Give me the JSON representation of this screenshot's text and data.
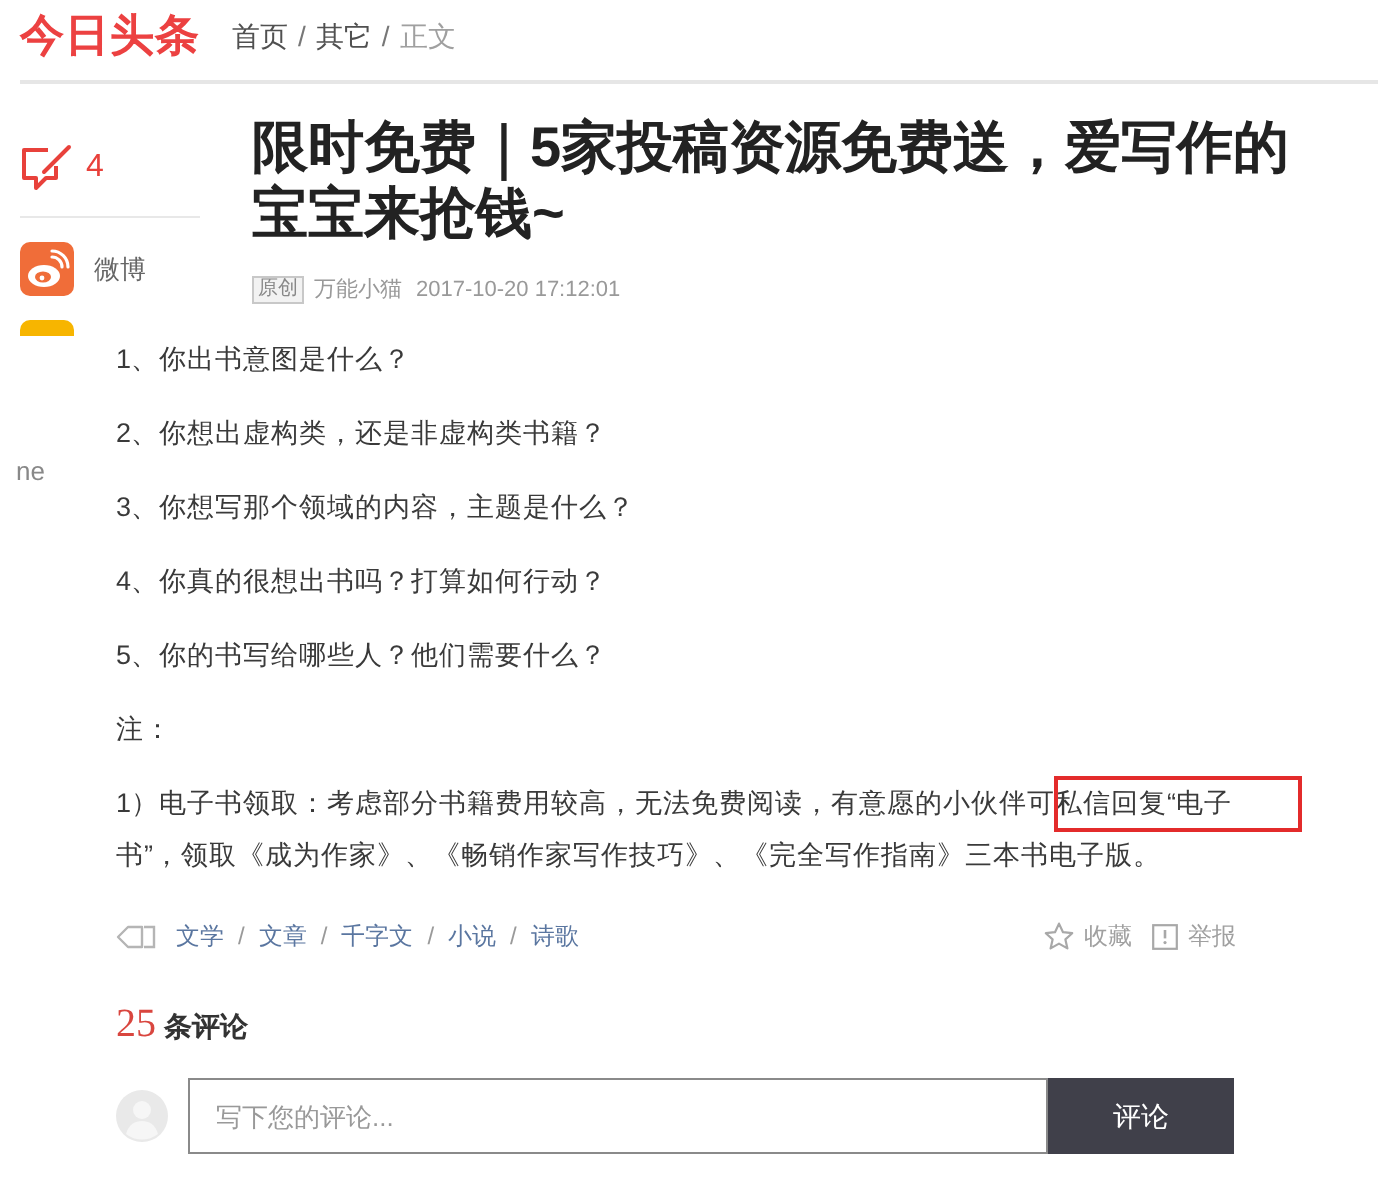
{
  "header": {
    "logo": "今日头条",
    "breadcrumb": [
      {
        "label": "首页",
        "current": false,
        "separator": "/"
      },
      {
        "label": "其它",
        "current": false,
        "separator": "/"
      },
      {
        "label": "正文",
        "current": true
      }
    ]
  },
  "sidebar": {
    "comment_count": "4",
    "share_items": [
      {
        "label": "微博"
      }
    ],
    "partial_label": "ne"
  },
  "article": {
    "title": "限时免费｜5家投稿资源免费送，爱写作的宝宝来抢钱~",
    "badge": "原创",
    "author": "万能小猫",
    "time": "2017-10-20 17:12:01",
    "body": [
      {
        "text": "1、你出书意图是什么？",
        "highlighted": false
      },
      {
        "text": "2、你想出虚构类，还是非虚构类书籍？",
        "highlighted": false
      },
      {
        "text": "3、你想写那个领域的内容，主题是什么？",
        "highlighted": false
      },
      {
        "text": "4、你真的很想出书吗？打算如何行动？",
        "highlighted": false
      },
      {
        "text": "5、你的书写给哪些人？他们需要什么？",
        "highlighted": false
      },
      {
        "text": "注：",
        "highlighted": false
      },
      {
        "text": "1）电子书领取：考虑部分书籍费用较高，无法免费阅读，有意愿的小伙伴可私信回复“电子书”，领取《成为作家》、《畅销作家写作技巧》、《完全写作指南》三本书电子版。",
        "highlighted": true
      }
    ],
    "tags": [
      {
        "label": "文学",
        "separator": "/"
      },
      {
        "label": "文章",
        "separator": "/"
      },
      {
        "label": "千字文",
        "separator": "/"
      },
      {
        "label": "小说",
        "separator": "/"
      },
      {
        "label": "诗歌"
      }
    ],
    "actions": [
      {
        "kind": "favorite",
        "label": "收藏"
      },
      {
        "kind": "report",
        "label": "举报"
      }
    ]
  },
  "comments": {
    "count": "25",
    "label": "条评论",
    "placeholder": "写下您的评论...",
    "submit": "评论"
  }
}
